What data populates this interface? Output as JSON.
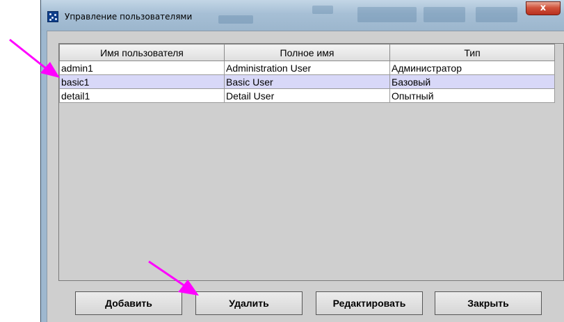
{
  "window": {
    "title": "Управление пользователями",
    "close_label": "x"
  },
  "table": {
    "columns": [
      "Имя пользователя",
      "Полное имя",
      "Тип"
    ],
    "rows": [
      {
        "username": "admin1",
        "fullname": "Administration User",
        "type": "Администратор",
        "selected": false
      },
      {
        "username": "basic1",
        "fullname": "Basic User",
        "type": "Базовый",
        "selected": true
      },
      {
        "username": "detail1",
        "fullname": "Detail User",
        "type": "Опытный",
        "selected": false
      }
    ]
  },
  "buttons": {
    "add": "Добавить",
    "delete": "Удалить",
    "edit": "Редактировать",
    "close": "Закрыть"
  },
  "colors": {
    "annotation_arrow": "#ff00ff",
    "selected_row": "#d8d8f8",
    "close_button": "#c8432f"
  }
}
